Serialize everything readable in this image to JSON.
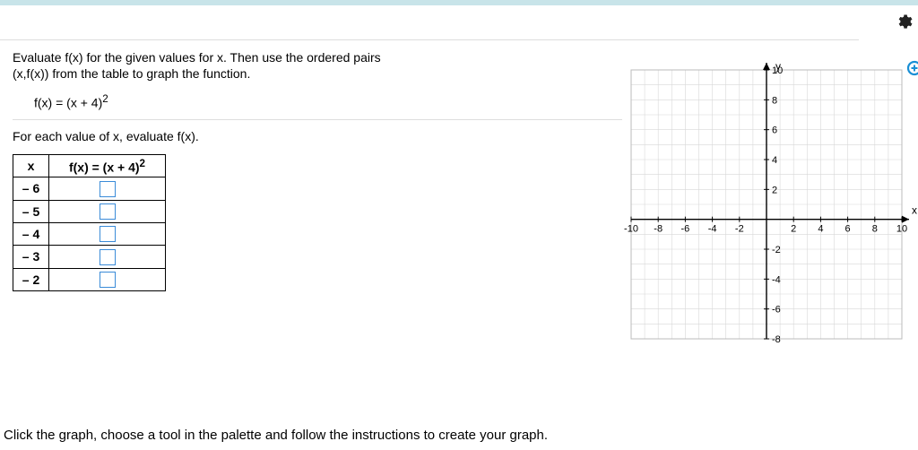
{
  "icons": {
    "gear": "gear-icon",
    "zoom": "zoom-in-icon"
  },
  "problem": {
    "line1": "Evaluate f(x) for the given values for x.  Then use the ordered pairs",
    "line2": "(x,f(x)) from the table to graph the function.",
    "formula_prefix": "f(x) = (x + 4)",
    "formula_exp": "2",
    "instruction": "For each value of x, evaluate f(x)."
  },
  "table": {
    "header_x": "x",
    "header_fx_prefix": "f(x) = (x + 4)",
    "header_fx_exp": "2",
    "rows": [
      {
        "x": "– 6"
      },
      {
        "x": "– 5"
      },
      {
        "x": "– 4"
      },
      {
        "x": "– 3"
      },
      {
        "x": "– 2"
      }
    ]
  },
  "chart_data": {
    "type": "scatter",
    "title": "",
    "xlabel": "x",
    "ylabel": "y",
    "xlim": [
      -10,
      10
    ],
    "ylim": [
      -8,
      10
    ],
    "xticks": [
      -10,
      -8,
      -6,
      -4,
      -2,
      2,
      4,
      6,
      8,
      10
    ],
    "yticks": [
      -8,
      -6,
      -4,
      -2,
      2,
      4,
      6,
      8,
      10
    ],
    "grid": true,
    "series": []
  },
  "footer": {
    "text": "Click the graph, choose a tool in the palette and follow the instructions to create your graph."
  }
}
